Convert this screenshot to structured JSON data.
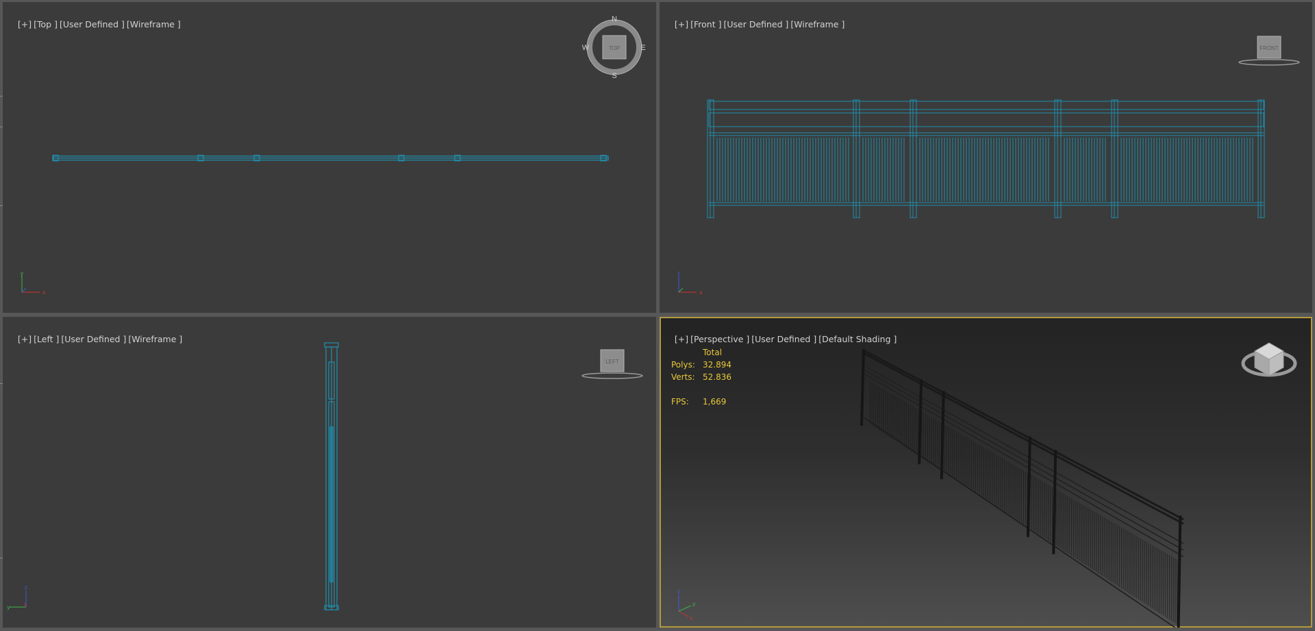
{
  "viewports": {
    "top": {
      "plus": "[+]",
      "view": "[Top ]",
      "mode": "[User Defined ]",
      "shading": "[Wireframe ]",
      "compass": {
        "n": "N",
        "s": "S",
        "e": "E",
        "w": "W",
        "cube": "TOP"
      },
      "axes": {
        "a": "y",
        "b": "x"
      }
    },
    "front": {
      "plus": "[+]",
      "view": "[Front ]",
      "mode": "[User Defined ]",
      "shading": "[Wireframe ]",
      "cube": "FRONT",
      "axes": {
        "a": "z",
        "b": "x"
      }
    },
    "left": {
      "plus": "[+]",
      "view": "[Left ]",
      "mode": "[User Defined ]",
      "shading": "[Wireframe ]",
      "cube": "LEFT",
      "axes": {
        "a": "z",
        "b": "y"
      }
    },
    "perspective": {
      "plus": "[+]",
      "view": "[Perspective ]",
      "mode": "[User Defined ]",
      "shading": "[Default Shading ]",
      "axes": {
        "a": "z",
        "b": "x",
        "c": "y"
      }
    }
  },
  "stats": {
    "header": "Total",
    "polys_label": "Polys:",
    "polys": "32.894",
    "verts_label": "Verts:",
    "verts": "52.836",
    "fps_label": "FPS:",
    "fps": "1,669"
  },
  "colors": {
    "wire": "#1e8fae",
    "active_border": "#b49a3d",
    "stats_text": "#e8c83a"
  }
}
